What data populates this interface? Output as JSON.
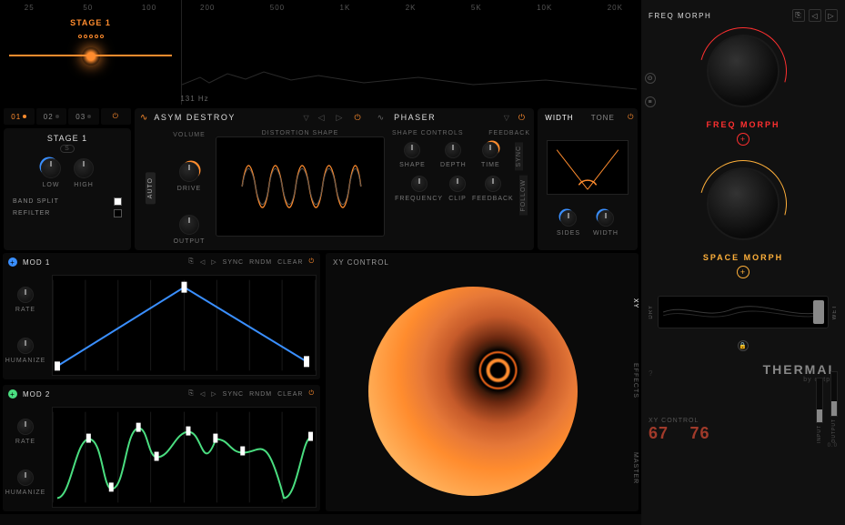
{
  "spectrum": {
    "ticks": [
      "25",
      "50",
      "100",
      "200",
      "500",
      "1K",
      "2K",
      "5K",
      "10K",
      "20K"
    ],
    "active_band_label": "STAGE 1",
    "freq_readout": "131 Hz"
  },
  "stage_tabs": [
    {
      "label": "01",
      "active": true
    },
    {
      "label": "02",
      "active": false
    },
    {
      "label": "03",
      "active": false
    }
  ],
  "stage_panel": {
    "title": "STAGE 1",
    "solo": "S",
    "low": "LOW",
    "high": "HIGH",
    "band_split": "BAND SPLIT",
    "refilter": "REFILTER",
    "band_split_on": true,
    "refilter_on": false
  },
  "distortion": {
    "title": "ASYM DESTROY",
    "auto": "AUTO",
    "volume": "VOLUME",
    "drive": "DRIVE",
    "output": "OUTPUT",
    "shape_label": "DISTORTION SHAPE",
    "shape_controls": "SHAPE CONTROLS",
    "shape": "SHAPE",
    "depth": "DEPTH",
    "frequency": "FREQUENCY",
    "clip": "CLIP"
  },
  "phaser": {
    "title": "PHASER",
    "feedback_hdr": "FEEDBACK",
    "time": "TIME",
    "feedback": "FEEDBACK",
    "sync": "SYNC",
    "follow": "FOLLOW"
  },
  "width": {
    "tab_width": "WIDTH",
    "tab_tone": "TONE",
    "sides": "SIDES",
    "width": "WIDTH"
  },
  "mods": [
    {
      "title": "MOD 1",
      "color": "blue"
    },
    {
      "title": "MOD 2",
      "color": "green"
    }
  ],
  "mod_buttons": {
    "preset": "⎘",
    "back": "◁",
    "fwd": "▷",
    "sync": "SYNC",
    "rndm": "RNDM",
    "clear": "CLEAR"
  },
  "mod_knobs": {
    "rate": "RATE",
    "humanize": "HUMANIZE"
  },
  "xy": {
    "title": "XY CONTROL",
    "tabs": [
      "XY",
      "EFFECTS",
      "MASTER"
    ]
  },
  "right": {
    "title": "FREQ MORPH",
    "knob1": "FREQ MORPH",
    "knob2": "SPACE MORPH",
    "add": "+",
    "dry": "DRY",
    "wet": "WET",
    "brand": "THERMAL",
    "brand_sub": "by output",
    "xy_label": "XY CONTROL",
    "xy_x": "67",
    "xy_y": "76",
    "input": "INPUT",
    "output": "OUTPUT",
    "scale": "0.0"
  }
}
